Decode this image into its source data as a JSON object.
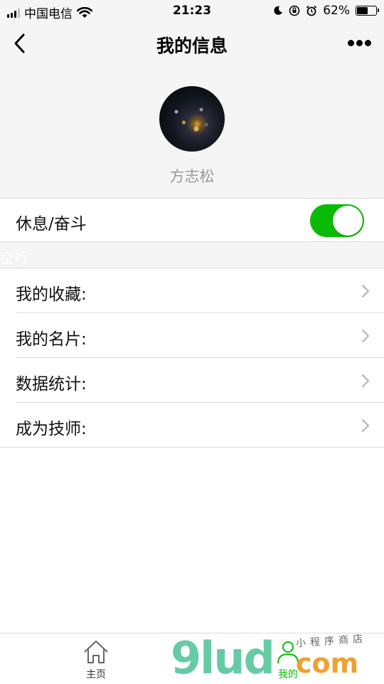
{
  "status_bar": {
    "carrier": "中国电信",
    "time": "21:23",
    "battery_percent": "62%",
    "battery_level": 0.62,
    "icons": [
      "signal-icon",
      "wifi-icon",
      "moon-icon",
      "rotation-lock-icon",
      "alarm-icon",
      "battery-icon"
    ]
  },
  "nav": {
    "title": "我的信息",
    "back_icon": "chevron-left-icon",
    "more_icon": "more-dots-icon"
  },
  "profile": {
    "name": "方志松"
  },
  "toggle": {
    "label": "休息/奋斗",
    "on": true,
    "color": "#09bb07"
  },
  "section": {
    "label": "空行"
  },
  "menu": {
    "items": [
      {
        "label": "我的收藏:"
      },
      {
        "label": "我的名片:"
      },
      {
        "label": "数据统计:"
      },
      {
        "label": "成为技师:"
      }
    ]
  },
  "tabbar": {
    "tabs": [
      {
        "label": "主页",
        "icon": "home-icon"
      },
      {
        "label": "我的",
        "icon": "user-icon",
        "active": true
      }
    ]
  },
  "watermark": {
    "brand": "9lud",
    "suffix": "com",
    "tagline": "小程序商店"
  },
  "colors": {
    "accent": "#09bb07",
    "background": "#f5f5f5"
  }
}
